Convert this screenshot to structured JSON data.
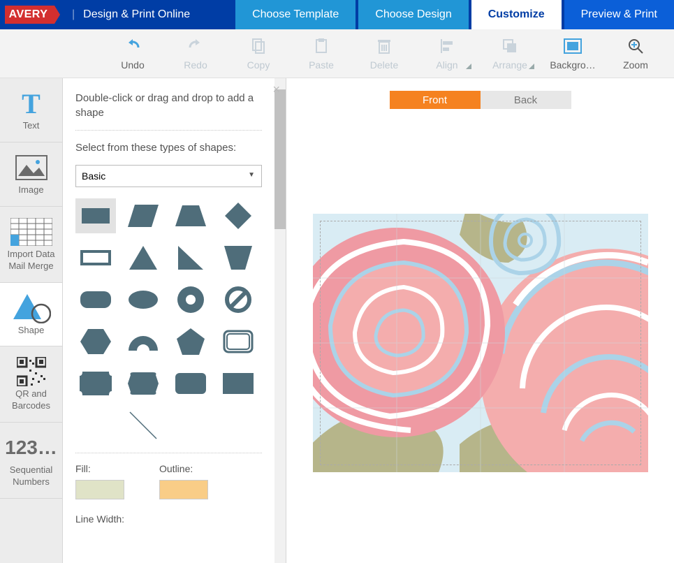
{
  "header": {
    "logo": "AVERY",
    "app_title": "Design & Print Online",
    "tabs": [
      {
        "label": "Choose Template"
      },
      {
        "label": "Choose Design"
      },
      {
        "label": "Customize"
      },
      {
        "label": "Preview & Print"
      }
    ]
  },
  "toolbar": {
    "undo": "Undo",
    "redo": "Redo",
    "copy": "Copy",
    "paste": "Paste",
    "delete": "Delete",
    "align": "Align",
    "arrange": "Arrange",
    "background": "Backgro…",
    "zoom": "Zoom"
  },
  "sidebar": {
    "text": "Text",
    "image": "Image",
    "import": "Import Data\nMail Merge",
    "shape": "Shape",
    "qr": "QR and\nBarcodes",
    "seq": "Sequential\nNumbers",
    "seq_icon": "123…"
  },
  "panel": {
    "intro": "Double-click or drag and drop to add a shape",
    "select_label": "Select from these types of shapes:",
    "dropdown_value": "Basic",
    "fill_label": "Fill:",
    "outline_label": "Outline:",
    "line_width_label": "Line Width:",
    "fill_color": "#e0e3c7",
    "outline_color": "#f9cd87"
  },
  "canvas": {
    "front": "Front",
    "back": "Back"
  }
}
